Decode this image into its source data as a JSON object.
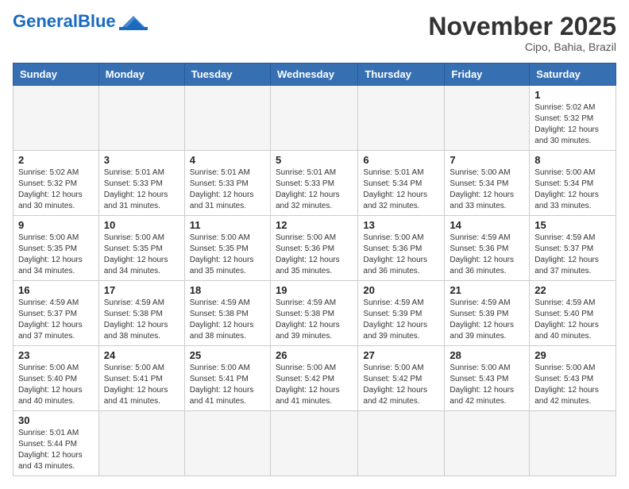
{
  "header": {
    "logo_general": "General",
    "logo_blue": "Blue",
    "month_title": "November 2025",
    "location": "Cipo, Bahia, Brazil"
  },
  "weekdays": [
    "Sunday",
    "Monday",
    "Tuesday",
    "Wednesday",
    "Thursday",
    "Friday",
    "Saturday"
  ],
  "weeks": [
    [
      {
        "day": "",
        "sunrise": "",
        "sunset": "",
        "daylight": ""
      },
      {
        "day": "",
        "sunrise": "",
        "sunset": "",
        "daylight": ""
      },
      {
        "day": "",
        "sunrise": "",
        "sunset": "",
        "daylight": ""
      },
      {
        "day": "",
        "sunrise": "",
        "sunset": "",
        "daylight": ""
      },
      {
        "day": "",
        "sunrise": "",
        "sunset": "",
        "daylight": ""
      },
      {
        "day": "",
        "sunrise": "",
        "sunset": "",
        "daylight": ""
      },
      {
        "day": "1",
        "sunrise": "Sunrise: 5:02 AM",
        "sunset": "Sunset: 5:32 PM",
        "daylight": "Daylight: 12 hours and 30 minutes."
      }
    ],
    [
      {
        "day": "2",
        "sunrise": "Sunrise: 5:02 AM",
        "sunset": "Sunset: 5:32 PM",
        "daylight": "Daylight: 12 hours and 30 minutes."
      },
      {
        "day": "3",
        "sunrise": "Sunrise: 5:01 AM",
        "sunset": "Sunset: 5:33 PM",
        "daylight": "Daylight: 12 hours and 31 minutes."
      },
      {
        "day": "4",
        "sunrise": "Sunrise: 5:01 AM",
        "sunset": "Sunset: 5:33 PM",
        "daylight": "Daylight: 12 hours and 31 minutes."
      },
      {
        "day": "5",
        "sunrise": "Sunrise: 5:01 AM",
        "sunset": "Sunset: 5:33 PM",
        "daylight": "Daylight: 12 hours and 32 minutes."
      },
      {
        "day": "6",
        "sunrise": "Sunrise: 5:01 AM",
        "sunset": "Sunset: 5:34 PM",
        "daylight": "Daylight: 12 hours and 32 minutes."
      },
      {
        "day": "7",
        "sunrise": "Sunrise: 5:00 AM",
        "sunset": "Sunset: 5:34 PM",
        "daylight": "Daylight: 12 hours and 33 minutes."
      },
      {
        "day": "8",
        "sunrise": "Sunrise: 5:00 AM",
        "sunset": "Sunset: 5:34 PM",
        "daylight": "Daylight: 12 hours and 33 minutes."
      }
    ],
    [
      {
        "day": "9",
        "sunrise": "Sunrise: 5:00 AM",
        "sunset": "Sunset: 5:35 PM",
        "daylight": "Daylight: 12 hours and 34 minutes."
      },
      {
        "day": "10",
        "sunrise": "Sunrise: 5:00 AM",
        "sunset": "Sunset: 5:35 PM",
        "daylight": "Daylight: 12 hours and 34 minutes."
      },
      {
        "day": "11",
        "sunrise": "Sunrise: 5:00 AM",
        "sunset": "Sunset: 5:35 PM",
        "daylight": "Daylight: 12 hours and 35 minutes."
      },
      {
        "day": "12",
        "sunrise": "Sunrise: 5:00 AM",
        "sunset": "Sunset: 5:36 PM",
        "daylight": "Daylight: 12 hours and 35 minutes."
      },
      {
        "day": "13",
        "sunrise": "Sunrise: 5:00 AM",
        "sunset": "Sunset: 5:36 PM",
        "daylight": "Daylight: 12 hours and 36 minutes."
      },
      {
        "day": "14",
        "sunrise": "Sunrise: 4:59 AM",
        "sunset": "Sunset: 5:36 PM",
        "daylight": "Daylight: 12 hours and 36 minutes."
      },
      {
        "day": "15",
        "sunrise": "Sunrise: 4:59 AM",
        "sunset": "Sunset: 5:37 PM",
        "daylight": "Daylight: 12 hours and 37 minutes."
      }
    ],
    [
      {
        "day": "16",
        "sunrise": "Sunrise: 4:59 AM",
        "sunset": "Sunset: 5:37 PM",
        "daylight": "Daylight: 12 hours and 37 minutes."
      },
      {
        "day": "17",
        "sunrise": "Sunrise: 4:59 AM",
        "sunset": "Sunset: 5:38 PM",
        "daylight": "Daylight: 12 hours and 38 minutes."
      },
      {
        "day": "18",
        "sunrise": "Sunrise: 4:59 AM",
        "sunset": "Sunset: 5:38 PM",
        "daylight": "Daylight: 12 hours and 38 minutes."
      },
      {
        "day": "19",
        "sunrise": "Sunrise: 4:59 AM",
        "sunset": "Sunset: 5:38 PM",
        "daylight": "Daylight: 12 hours and 39 minutes."
      },
      {
        "day": "20",
        "sunrise": "Sunrise: 4:59 AM",
        "sunset": "Sunset: 5:39 PM",
        "daylight": "Daylight: 12 hours and 39 minutes."
      },
      {
        "day": "21",
        "sunrise": "Sunrise: 4:59 AM",
        "sunset": "Sunset: 5:39 PM",
        "daylight": "Daylight: 12 hours and 39 minutes."
      },
      {
        "day": "22",
        "sunrise": "Sunrise: 4:59 AM",
        "sunset": "Sunset: 5:40 PM",
        "daylight": "Daylight: 12 hours and 40 minutes."
      }
    ],
    [
      {
        "day": "23",
        "sunrise": "Sunrise: 5:00 AM",
        "sunset": "Sunset: 5:40 PM",
        "daylight": "Daylight: 12 hours and 40 minutes."
      },
      {
        "day": "24",
        "sunrise": "Sunrise: 5:00 AM",
        "sunset": "Sunset: 5:41 PM",
        "daylight": "Daylight: 12 hours and 41 minutes."
      },
      {
        "day": "25",
        "sunrise": "Sunrise: 5:00 AM",
        "sunset": "Sunset: 5:41 PM",
        "daylight": "Daylight: 12 hours and 41 minutes."
      },
      {
        "day": "26",
        "sunrise": "Sunrise: 5:00 AM",
        "sunset": "Sunset: 5:42 PM",
        "daylight": "Daylight: 12 hours and 41 minutes."
      },
      {
        "day": "27",
        "sunrise": "Sunrise: 5:00 AM",
        "sunset": "Sunset: 5:42 PM",
        "daylight": "Daylight: 12 hours and 42 minutes."
      },
      {
        "day": "28",
        "sunrise": "Sunrise: 5:00 AM",
        "sunset": "Sunset: 5:43 PM",
        "daylight": "Daylight: 12 hours and 42 minutes."
      },
      {
        "day": "29",
        "sunrise": "Sunrise: 5:00 AM",
        "sunset": "Sunset: 5:43 PM",
        "daylight": "Daylight: 12 hours and 42 minutes."
      }
    ],
    [
      {
        "day": "30",
        "sunrise": "Sunrise: 5:01 AM",
        "sunset": "Sunset: 5:44 PM",
        "daylight": "Daylight: 12 hours and 43 minutes."
      },
      {
        "day": "",
        "sunrise": "",
        "sunset": "",
        "daylight": ""
      },
      {
        "day": "",
        "sunrise": "",
        "sunset": "",
        "daylight": ""
      },
      {
        "day": "",
        "sunrise": "",
        "sunset": "",
        "daylight": ""
      },
      {
        "day": "",
        "sunrise": "",
        "sunset": "",
        "daylight": ""
      },
      {
        "day": "",
        "sunrise": "",
        "sunset": "",
        "daylight": ""
      },
      {
        "day": "",
        "sunrise": "",
        "sunset": "",
        "daylight": ""
      }
    ]
  ]
}
